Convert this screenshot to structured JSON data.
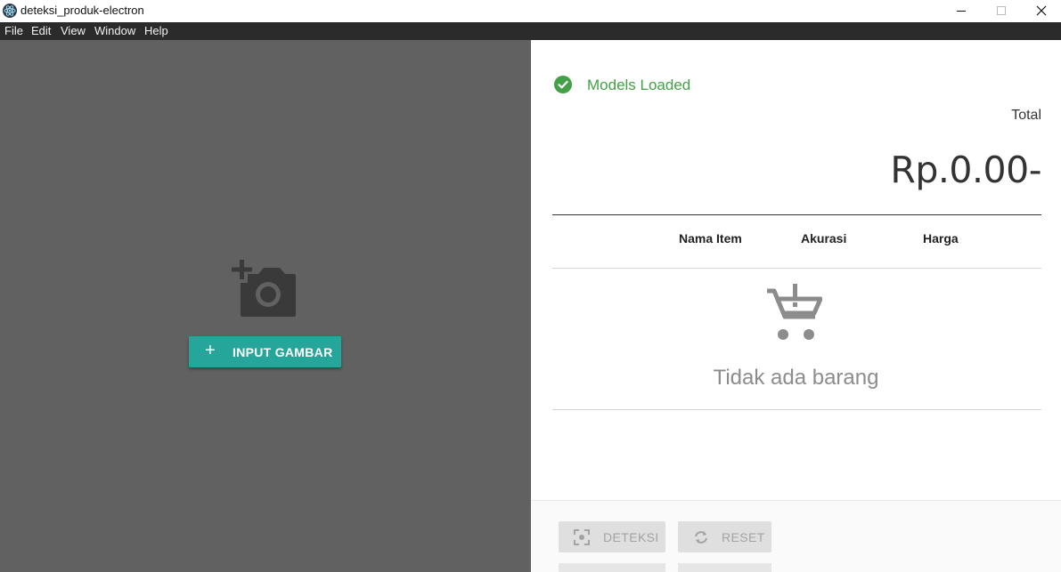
{
  "window": {
    "title": "deteksi_produk-electron"
  },
  "menu": [
    "File",
    "Edit",
    "View",
    "Window",
    "Help"
  ],
  "left": {
    "upload_icon": "add-photo-icon",
    "input_button_icon": "+",
    "input_button_label": "INPUT GAMBAR",
    "accent": "#26a69a"
  },
  "right": {
    "status_icon": "check-circle-icon",
    "status_text": "Models Loaded",
    "status_color": "#43a047",
    "total_label": "Total",
    "total_value": "Rp.0.00-",
    "table": {
      "columns": [
        "Nama Item",
        "Akurasi",
        "Harga"
      ],
      "rows": []
    },
    "empty_icon": "remove-shopping-cart-icon",
    "empty_text": "Tidak ada barang",
    "buttons": [
      {
        "label": "DETEKSI",
        "icon": "center-focus-icon",
        "disabled": true
      },
      {
        "label": "RESET",
        "icon": "refresh-icon",
        "disabled": true
      }
    ]
  }
}
